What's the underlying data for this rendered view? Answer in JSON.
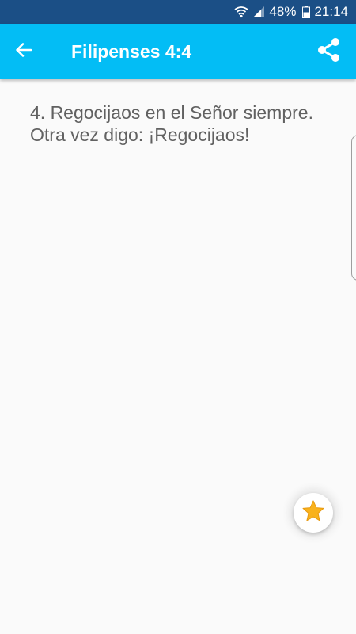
{
  "status_bar": {
    "battery": "48%",
    "time": "21:14",
    "icons": [
      "wifi-icon",
      "signal-icon",
      "battery-icon"
    ]
  },
  "app_bar": {
    "title": "Filipenses 4:4",
    "back_icon": "back-arrow-icon",
    "share_icon": "share-icon",
    "background_color": "#03bdf5"
  },
  "content": {
    "verse_text": "4. Regocijaos en el Señor siempre. Otra vez digo: ¡Regocijaos!"
  },
  "fab": {
    "icon": "star-icon",
    "star_color": "#f9b21c"
  }
}
